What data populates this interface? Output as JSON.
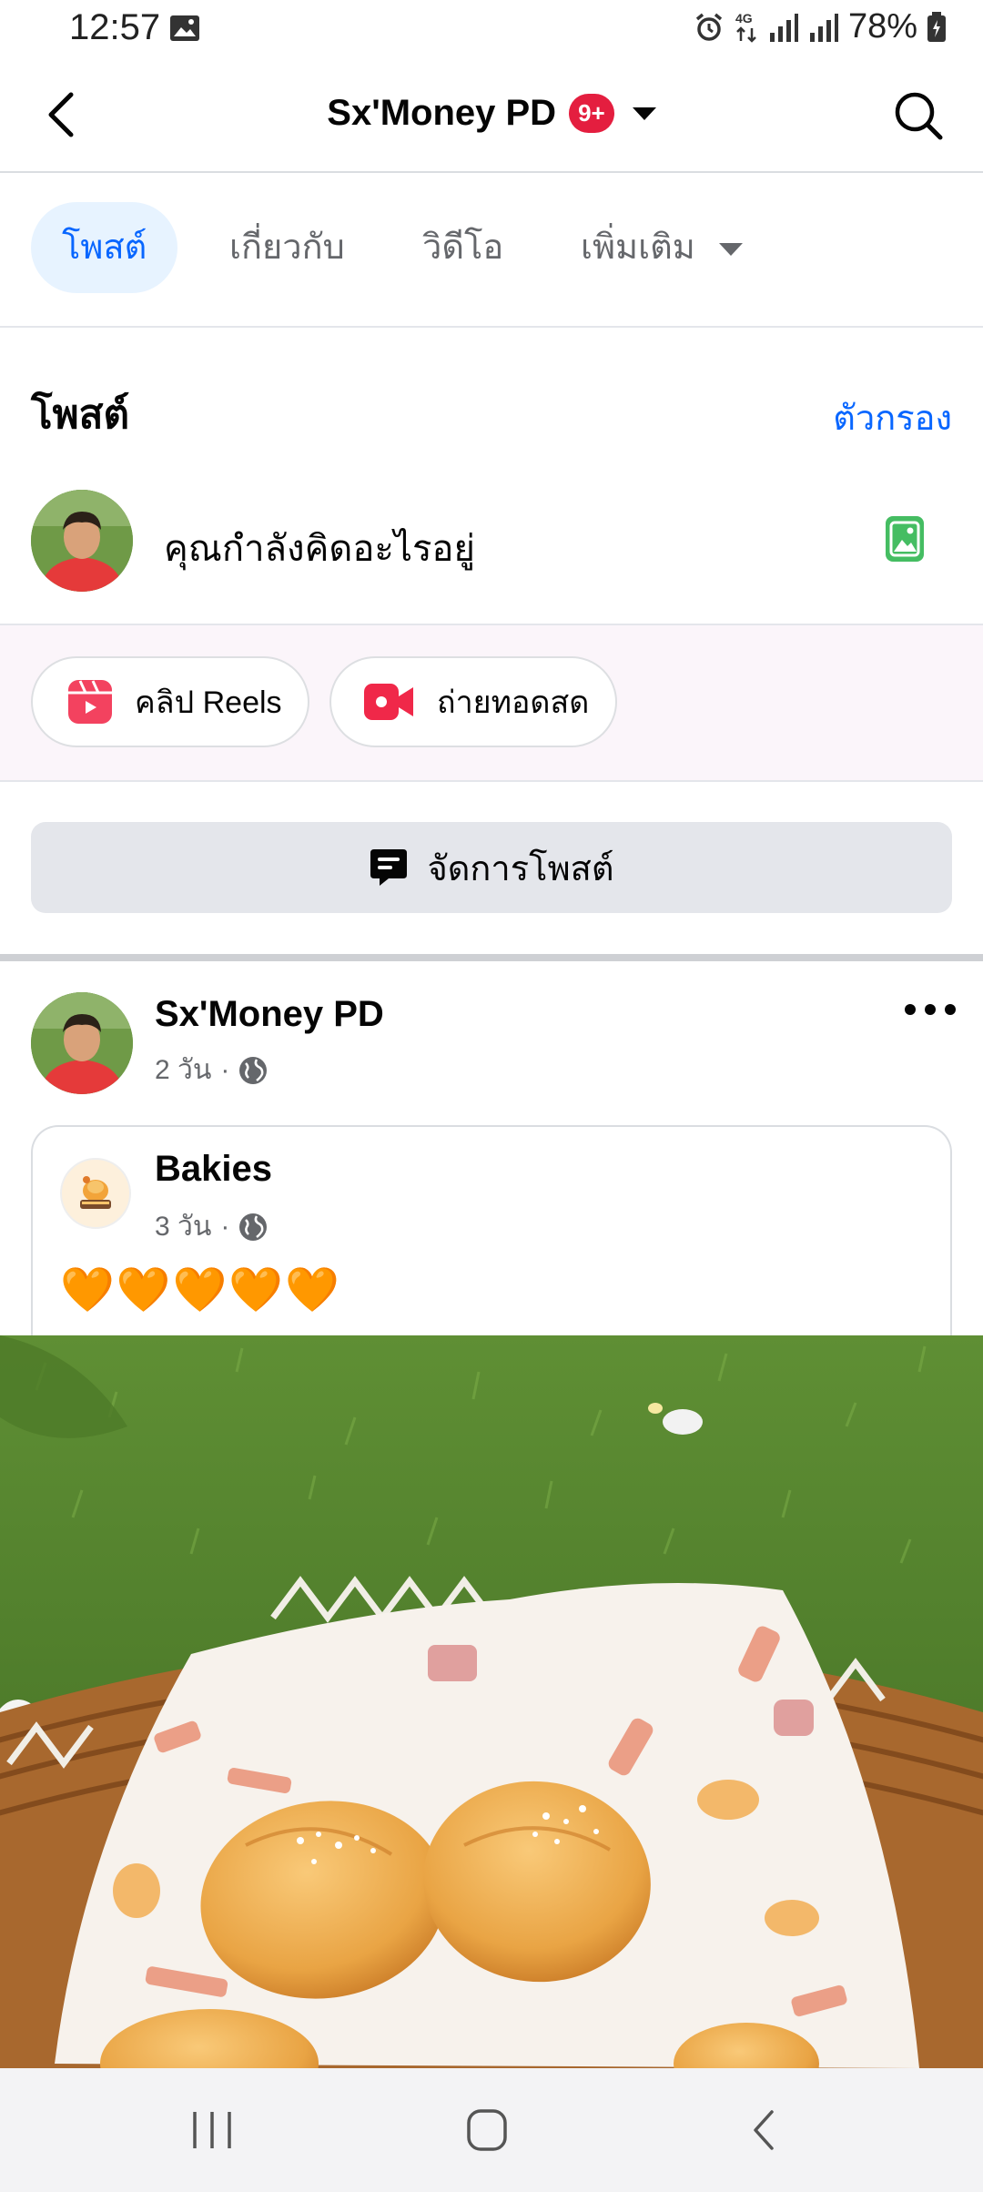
{
  "status_bar": {
    "time": "12:57",
    "icons": [
      "gallery-icon",
      "alarm-icon",
      "4g-icon",
      "signal-icon",
      "signal-icon",
      "battery-icon"
    ],
    "battery": "78%"
  },
  "header": {
    "title": "Sx'Money PD",
    "notification_badge": "9+"
  },
  "tabs": [
    {
      "label": "โพสต์",
      "active": true
    },
    {
      "label": "เกี่ยวกับ",
      "active": false
    },
    {
      "label": "วิดีโอ",
      "active": false
    },
    {
      "label": "เพิ่มเติม",
      "active": false
    }
  ],
  "posts_section": {
    "title": "โพสต์",
    "filter_label": "ตัวกรอง",
    "composer_placeholder": "คุณกำลังคิดอะไรอยู่"
  },
  "quick_actions": {
    "reels_label": "คลิป Reels",
    "live_label": "ถ่ายทอดสด"
  },
  "manage_posts_label": "จัดการโพสต์",
  "post": {
    "author": "Sx'Money PD",
    "time": "2 วัน",
    "separator": "·",
    "shared": {
      "author": "Bakies",
      "time": "3 วัน",
      "separator": "·",
      "text": "🧡🧡🧡🧡🧡"
    }
  },
  "colors": {
    "accent": "#0866ff",
    "badge": "#e41e3f",
    "reels": "#f3425f",
    "photo": "#45bd62"
  }
}
